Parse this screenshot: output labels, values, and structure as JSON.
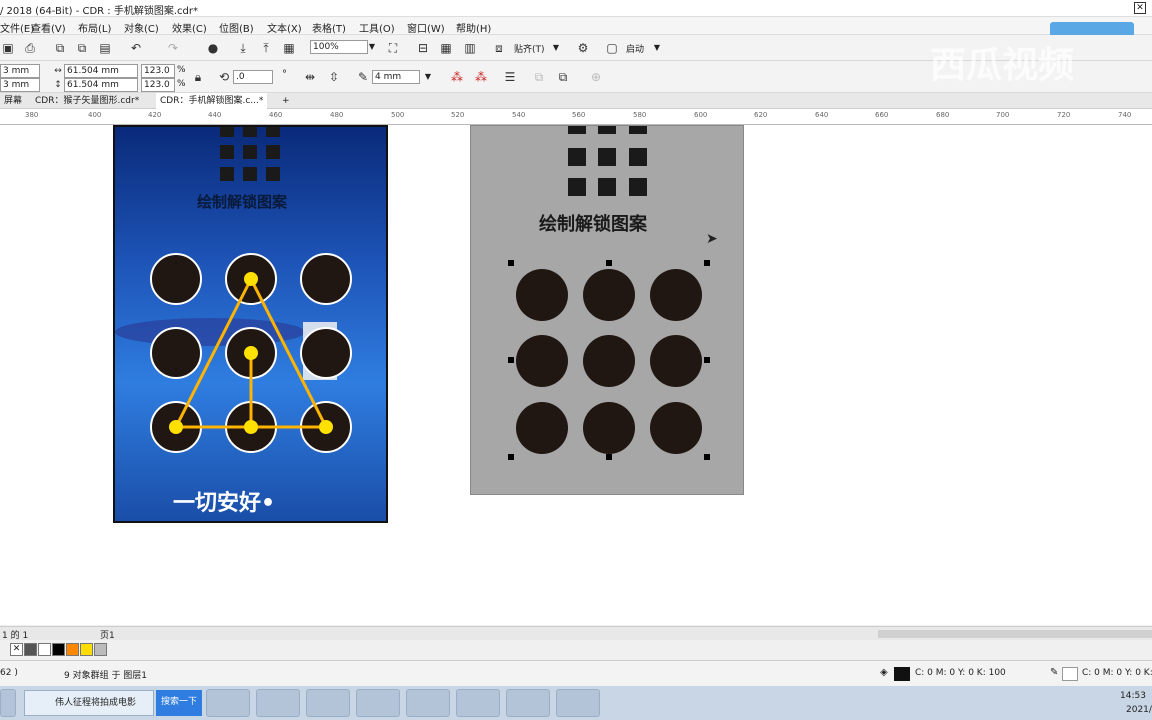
{
  "window": {
    "title": "/ 2018 (64-Bit) - CDR : 手机解锁图案.cdr*"
  },
  "menu": [
    "文件(E)",
    "查看(V)",
    "布局(L)",
    "对象(C)",
    "效果(C)",
    "位图(B)",
    "文本(X)",
    "表格(T)",
    "工具(O)",
    "窗口(W)",
    "帮助(H)"
  ],
  "toolbar1": {
    "zoom": "100%",
    "snap": "贴齐(T)",
    "launch": "启动"
  },
  "toolbar2": {
    "x": "3 mm",
    "y": "3 mm",
    "width": "61.504 mm",
    "height": "61.504 mm",
    "scale_x": "123.0",
    "scale_y": "123.0",
    "pct": "%",
    "angle": ".0",
    "deg": "°",
    "outline": "4 mm"
  },
  "tabs": [
    "屏幕",
    "CDR：猴子矢量图形.cdr*",
    "CDR：手机解锁图案.c...*"
  ],
  "ruler": [
    "380",
    "400",
    "420",
    "440",
    "460",
    "480",
    "500",
    "520",
    "540",
    "560",
    "580",
    "600",
    "620",
    "640",
    "660",
    "680",
    "700",
    "720",
    "740"
  ],
  "art1": {
    "title": "绘制解锁图案",
    "slogan": "一切安好•"
  },
  "art2": {
    "title": "绘制解锁图案"
  },
  "pages": {
    "nav": "1 的 1",
    "page": "页1"
  },
  "palette": [
    "#ffffff",
    "#555555",
    "#000000",
    "#ff8800",
    "#ffdd00",
    "#bbbbbb"
  ],
  "status": {
    "left": "62 )",
    "selection": "9 对象群组 于 图层1",
    "fill": "C: 0 M: 0 Y: 0 K: 100",
    "outline": "C: 0 M: 0 Y: 0 K:"
  },
  "taskbar": {
    "ie_tab": "伟人征程将拍成电影",
    "search": "搜索一下",
    "time": "14:53",
    "date": "2021/"
  },
  "watermark": "西瓜视频"
}
